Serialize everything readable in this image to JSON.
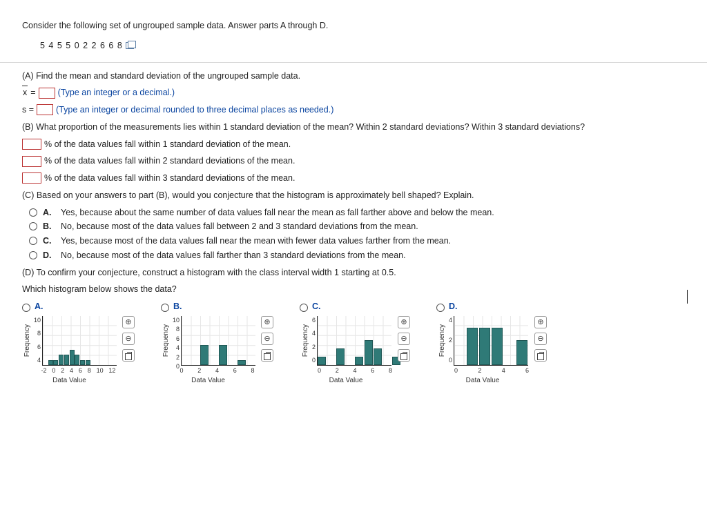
{
  "intro": "Consider the following set of ungrouped sample data. Answer parts A through D.",
  "data_values": "5   4   5   5   0   2   2   6   6   8",
  "partA": {
    "prompt": "(A) Find the mean and standard deviation of the ungrouped sample data.",
    "xbar_prefix": "x",
    "equals": " = ",
    "xbar_hint": "(Type an integer or a decimal.)",
    "s_prefix": "s = ",
    "s_hint": "(Type an integer or decimal rounded to three decimal places as needed.)"
  },
  "partB": {
    "prompt": "(B) What proportion of the measurements lies within 1 standard deviation of the mean? Within 2 standard deviations? Within 3 standard deviations?",
    "line1": "% of the data values fall within 1 standard deviation of the mean.",
    "line2": "% of the data values fall within 2 standard deviations of the mean.",
    "line3": "% of the data values fall within 3 standard deviations of the mean."
  },
  "partC": {
    "prompt": "(C) Based on your answers to part (B), would you conjecture that the histogram is approximately bell shaped? Explain.",
    "options": [
      {
        "letter": "A.",
        "text": "Yes, because about the same number of data values fall near the mean as fall farther above and below the mean."
      },
      {
        "letter": "B.",
        "text": "No, because most of the data values fall between 2 and 3 standard deviations from the mean."
      },
      {
        "letter": "C.",
        "text": "Yes, because most of the data values fall near the mean with fewer data values farther from the mean."
      },
      {
        "letter": "D.",
        "text": "No, because most of the data values fall farther than 3 standard deviations from the mean."
      }
    ]
  },
  "partD": {
    "prompt": "(D) To confirm your conjecture, construct a histogram with the class interval width 1 starting at 0.5.",
    "subprompt": "Which histogram below shows the data?",
    "options": [
      "A.",
      "B.",
      "C.",
      "D."
    ],
    "ylabel": "Frequency",
    "xlabel": "Data Value"
  },
  "chart_data": [
    {
      "type": "bar",
      "title": "A.",
      "xlabel": "Data Value",
      "ylabel": "Frequency",
      "ylim": [
        0,
        10
      ],
      "xlim": [
        -2,
        12
      ],
      "xticks": [
        "-2",
        "0",
        "2",
        "4",
        "6",
        "8",
        "10",
        "12"
      ],
      "yticks": [
        "10",
        "8",
        "6",
        "4"
      ],
      "bars": [
        {
          "x": -1,
          "h": 1
        },
        {
          "x": 0,
          "h": 1
        },
        {
          "x": 1,
          "h": 2
        },
        {
          "x": 2,
          "h": 2
        },
        {
          "x": 3,
          "h": 3
        },
        {
          "x": 4,
          "h": 2
        },
        {
          "x": 5,
          "h": 1
        },
        {
          "x": 6,
          "h": 1
        }
      ]
    },
    {
      "type": "bar",
      "title": "B.",
      "xlabel": "Data Value",
      "ylabel": "Frequency",
      "ylim": [
        0,
        10
      ],
      "xlim": [
        0,
        8
      ],
      "xticks": [
        "0",
        "2",
        "4",
        "6",
        "8"
      ],
      "yticks": [
        "10",
        "8",
        "6",
        "4",
        "2",
        "0"
      ],
      "bars": [
        {
          "x": 2,
          "h": 4
        },
        {
          "x": 4,
          "h": 4
        },
        {
          "x": 6,
          "h": 1
        }
      ]
    },
    {
      "type": "bar",
      "title": "C.",
      "xlabel": "Data Value",
      "ylabel": "Frequency",
      "ylim": [
        0,
        6
      ],
      "xlim": [
        0,
        8
      ],
      "xticks": [
        "0",
        "2",
        "4",
        "6",
        "8"
      ],
      "yticks": [
        "6",
        "4",
        "2",
        "0"
      ],
      "bars": [
        {
          "x": 0,
          "h": 1
        },
        {
          "x": 2,
          "h": 2
        },
        {
          "x": 4,
          "h": 1
        },
        {
          "x": 5,
          "h": 3
        },
        {
          "x": 6,
          "h": 2
        },
        {
          "x": 8,
          "h": 1
        }
      ]
    },
    {
      "type": "bar",
      "title": "D.",
      "xlabel": "Data Value",
      "ylabel": "Frequency",
      "ylim": [
        0,
        4
      ],
      "xlim": [
        0,
        6
      ],
      "xticks": [
        "0",
        "2",
        "4",
        "6"
      ],
      "yticks": [
        "4",
        "2",
        "0"
      ],
      "bars": [
        {
          "x": 1,
          "h": 3
        },
        {
          "x": 2,
          "h": 3
        },
        {
          "x": 3,
          "h": 3
        },
        {
          "x": 5,
          "h": 2
        }
      ]
    }
  ]
}
